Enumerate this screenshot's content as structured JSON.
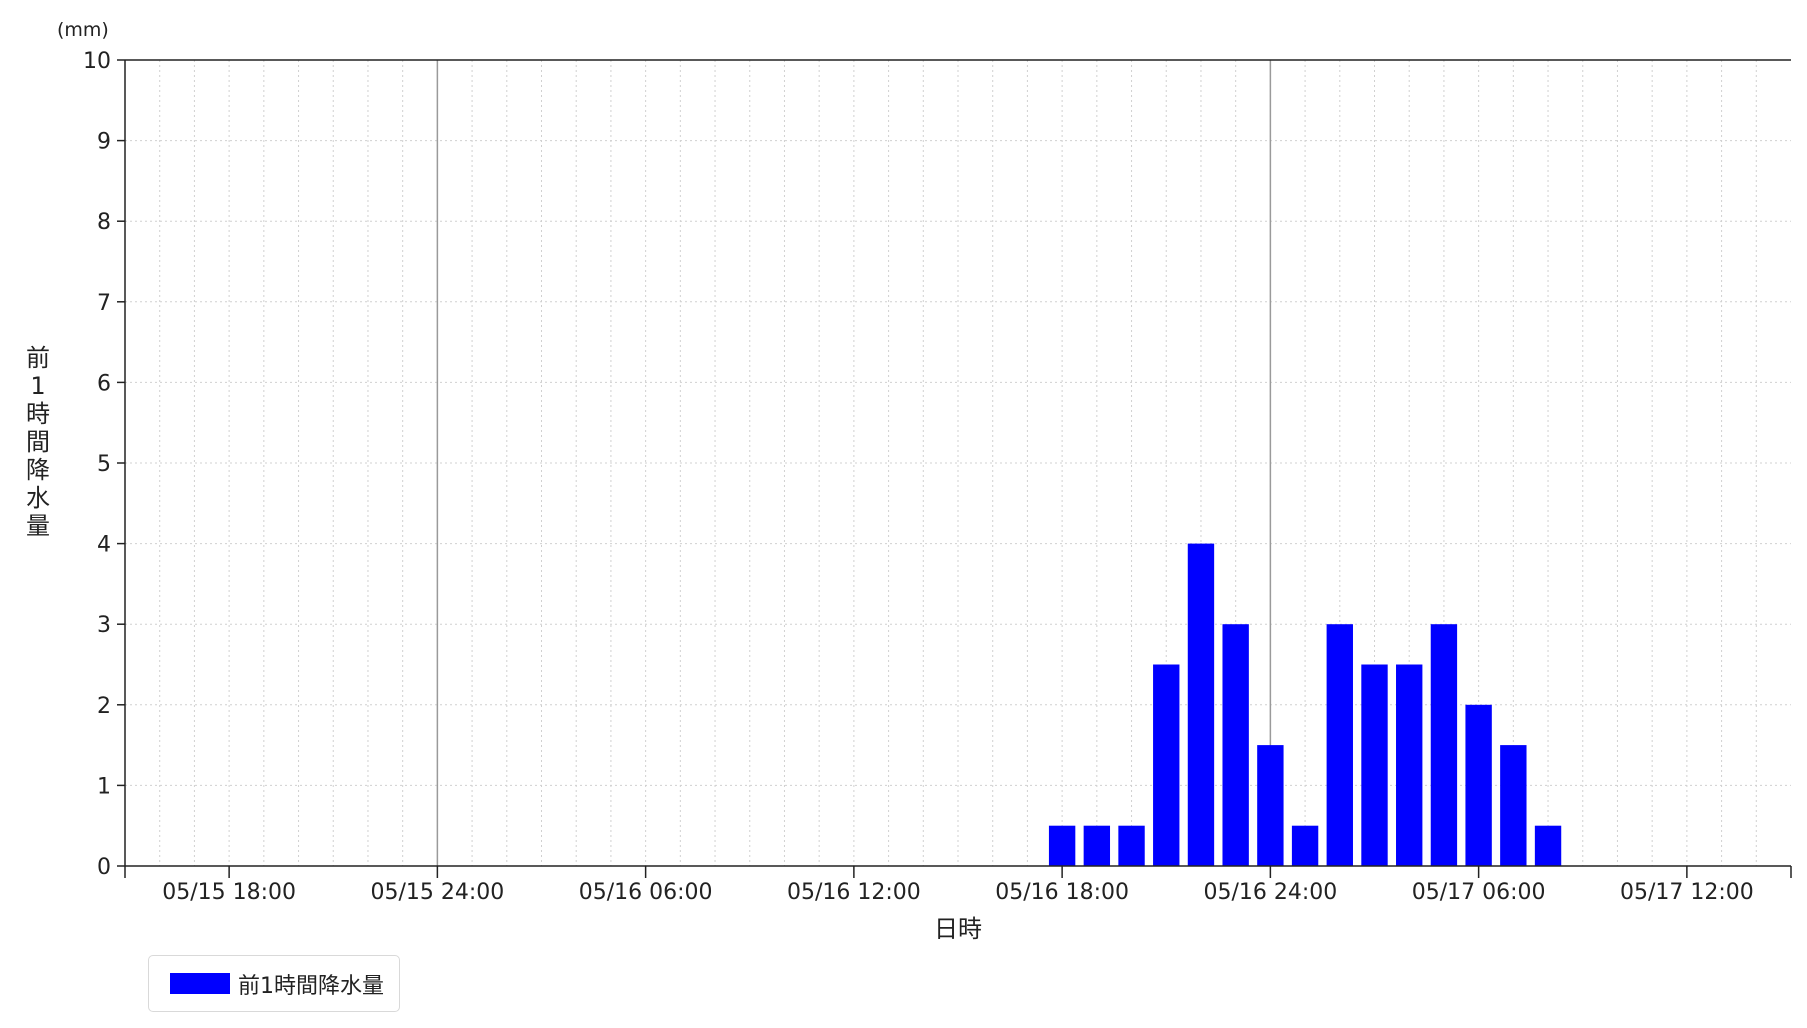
{
  "chart_data": {
    "type": "bar",
    "unit_label": "(mm)",
    "ylabel": "前1時間降水量",
    "xlabel": "日時",
    "ylim": [
      0,
      10
    ],
    "yticks": [
      0,
      1,
      2,
      3,
      4,
      5,
      6,
      7,
      8,
      9,
      10
    ],
    "x_range": [
      "05/15 15:00",
      "05/17 15:00"
    ],
    "x_tick_labels": [
      "05/15 18:00",
      "05/15 24:00",
      "05/16 06:00",
      "05/16 12:00",
      "05/16 18:00",
      "05/16 24:00",
      "05/17 06:00",
      "05/17 12:00"
    ],
    "grid": "dotted",
    "legend_position": "bottom-left",
    "bar_color": "#0000ff",
    "series": [
      {
        "name": "前1時間降水量",
        "times": [
          "05/16 18:00",
          "05/16 19:00",
          "05/16 20:00",
          "05/16 21:00",
          "05/16 22:00",
          "05/16 23:00",
          "05/16 24:00",
          "05/17 01:00",
          "05/17 02:00",
          "05/17 03:00",
          "05/17 04:00",
          "05/17 05:00",
          "05/17 06:00",
          "05/17 07:00",
          "05/17 08:00"
        ],
        "values": [
          0.5,
          0.5,
          0.5,
          2.5,
          4,
          3,
          1.5,
          0.5,
          3,
          2.5,
          2.5,
          3,
          2,
          1.5,
          0.5
        ]
      }
    ]
  },
  "legend": {
    "label": "前1時間降水量"
  }
}
